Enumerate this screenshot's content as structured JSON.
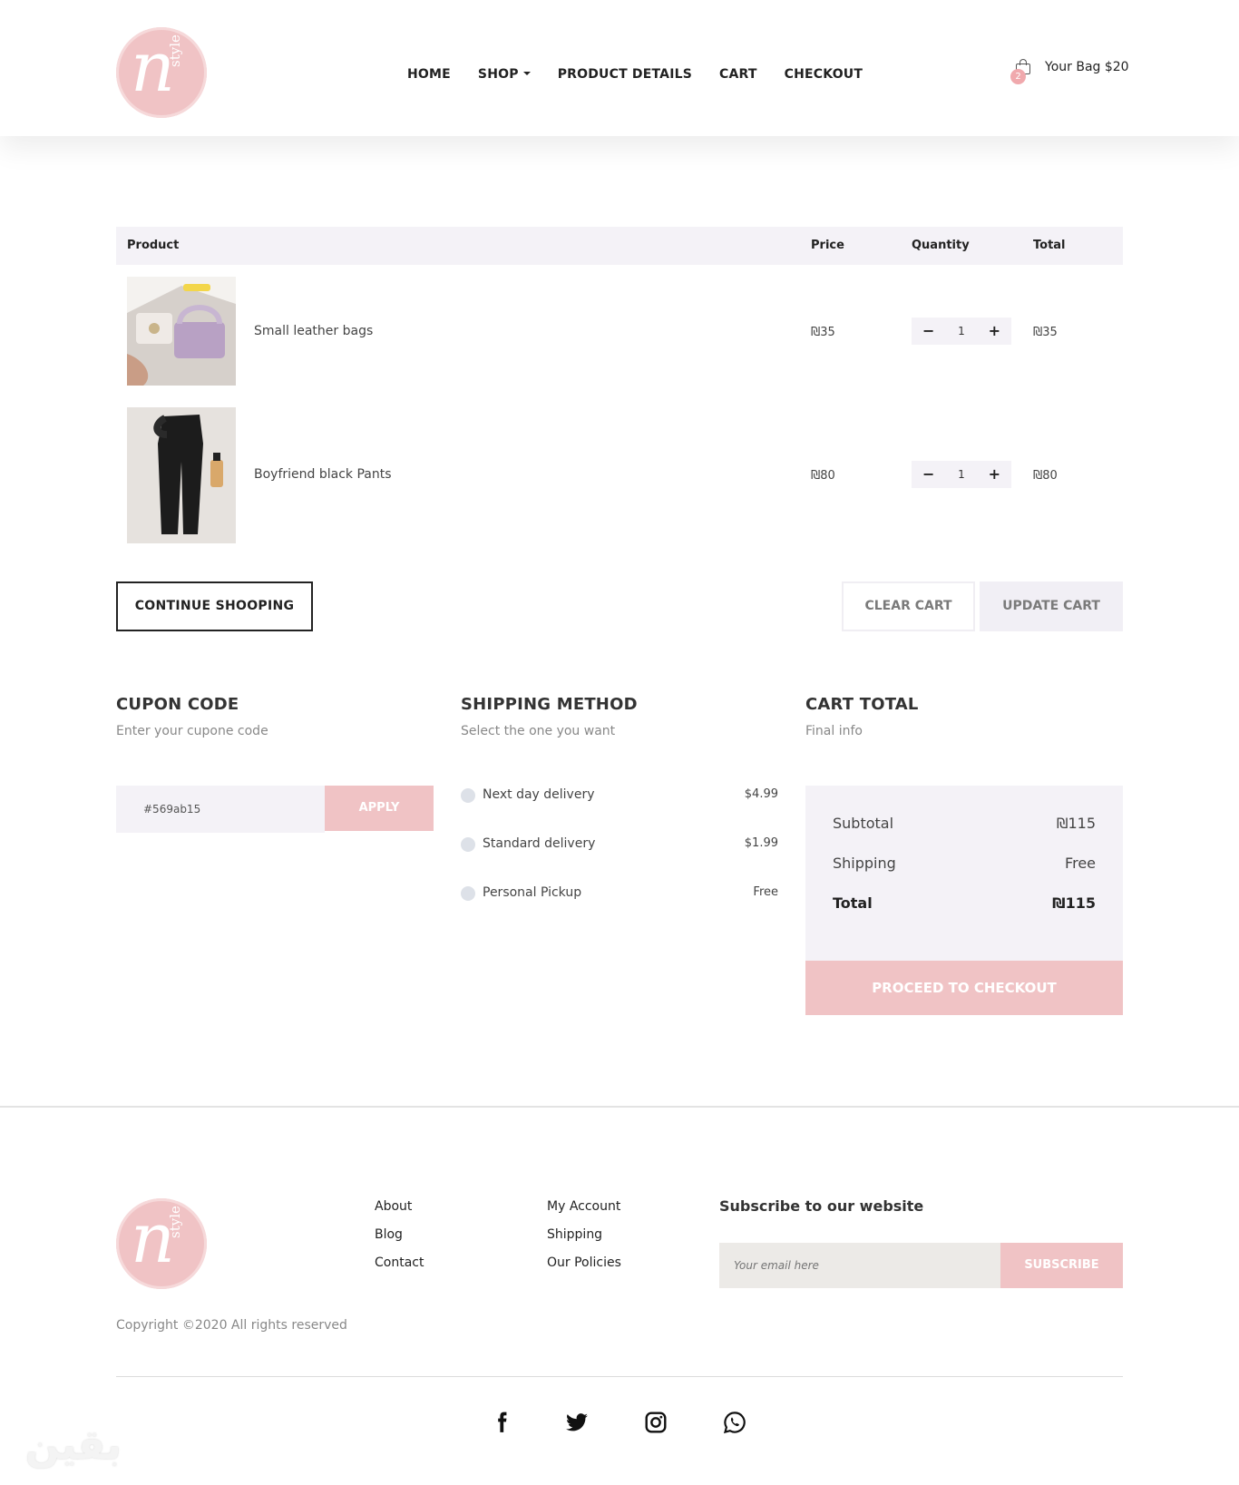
{
  "brand": {
    "logo_letter": "n",
    "logo_sub": "style",
    "accent": "#f0c3c5"
  },
  "nav": {
    "items": [
      {
        "label": "HOME"
      },
      {
        "label": "SHOP"
      },
      {
        "label": "PRODUCT DETAILS"
      },
      {
        "label": "CART"
      },
      {
        "label": "CHECKOUT"
      }
    ]
  },
  "bag": {
    "count": "2",
    "label": "Your Bag $20"
  },
  "cart": {
    "headers": {
      "product": "Product",
      "price": "Price",
      "quantity": "Quantity",
      "total": "Total"
    },
    "items": [
      {
        "name": "Small leather bags",
        "price": "₪35",
        "qty": "1",
        "total": "₪35",
        "minus": "−",
        "plus": "+"
      },
      {
        "name": "Boyfriend black Pants",
        "price": "₪80",
        "qty": "1",
        "total": "₪80",
        "minus": "−",
        "plus": "+"
      }
    ]
  },
  "actions": {
    "continue": "CONTINUE SHOOPING",
    "clear": "CLEAR CART",
    "update": "UPDATE CART"
  },
  "coupon": {
    "title": "CUPON CODE",
    "subtitle": "Enter your cupone code",
    "value": "#569ab15",
    "apply": "APPLY"
  },
  "shipping": {
    "title": "SHIPPING METHOD",
    "subtitle": "Select the one you want",
    "options": [
      {
        "name": "Next day delivery",
        "price": "$4.99"
      },
      {
        "name": "Standard delivery",
        "price": "$1.99"
      },
      {
        "name": "Personal Pickup",
        "price": "Free"
      }
    ]
  },
  "totals": {
    "title": "CART TOTAL",
    "subtitle": "Final info",
    "subtotal_label": "Subtotal",
    "subtotal": "₪115",
    "shipping_label": "Shipping",
    "shipping": "Free",
    "total_label": "Total",
    "total": "₪115",
    "checkout": "PROCEED TO CHECKOUT"
  },
  "footer": {
    "links_col1": [
      "About",
      "Blog",
      "Contact"
    ],
    "links_col2": [
      "My Account",
      "Shipping",
      "Our Policies"
    ],
    "subscribe_title": "Subscribe to our website",
    "email_placeholder": "Your email here",
    "subscribe_btn": "SUBSCRIBE",
    "copyright": "Copyright ©2020 All rights reserved",
    "social": [
      "facebook-icon",
      "twitter-icon",
      "instagram-icon",
      "whatsapp-icon"
    ]
  }
}
